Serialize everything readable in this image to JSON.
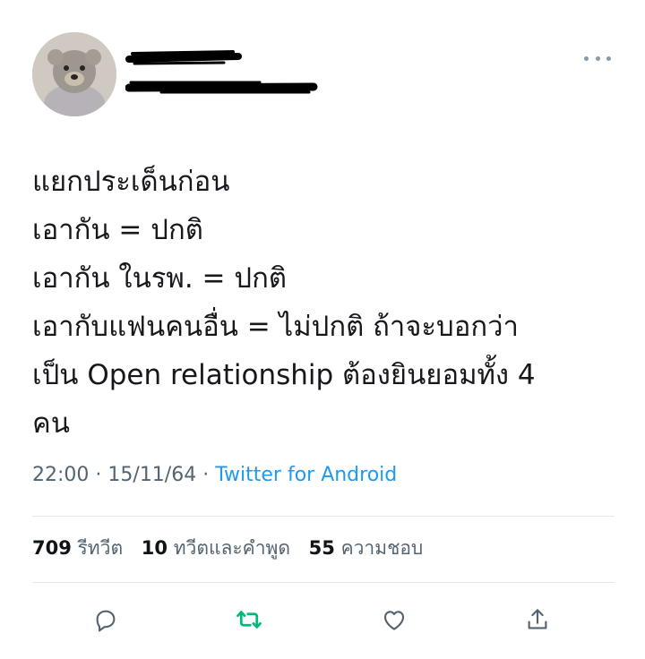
{
  "tweet": {
    "lines": [
      "แยกประเด็นก่อน",
      "เอากัน = ปกติ",
      "เอากัน ในรพ. = ปกติ",
      "เอากับแฟนคนอื่น = ไม่ปกติ ถ้าจะบอกว่า",
      "เป็น Open relationship ต้องยินยอมทั้ง 4",
      "คน"
    ],
    "time": "22:00",
    "date": "15/11/64",
    "separator": "·",
    "source": "Twitter for Android"
  },
  "stats": {
    "retweets_count": "709",
    "retweets_label": "รีทวีต",
    "quotes_count": "10",
    "quotes_label": "ทวีตและคำพูด",
    "likes_count": "55",
    "likes_label": "ความชอบ"
  },
  "icons": {
    "more": "more-dots-icon",
    "reply": "reply-icon",
    "retweet": "retweet-icon",
    "like": "heart-icon",
    "share": "share-icon"
  },
  "colors": {
    "retweet_active": "#00ba7c",
    "link": "#1d9bf0",
    "muted": "#536471"
  }
}
